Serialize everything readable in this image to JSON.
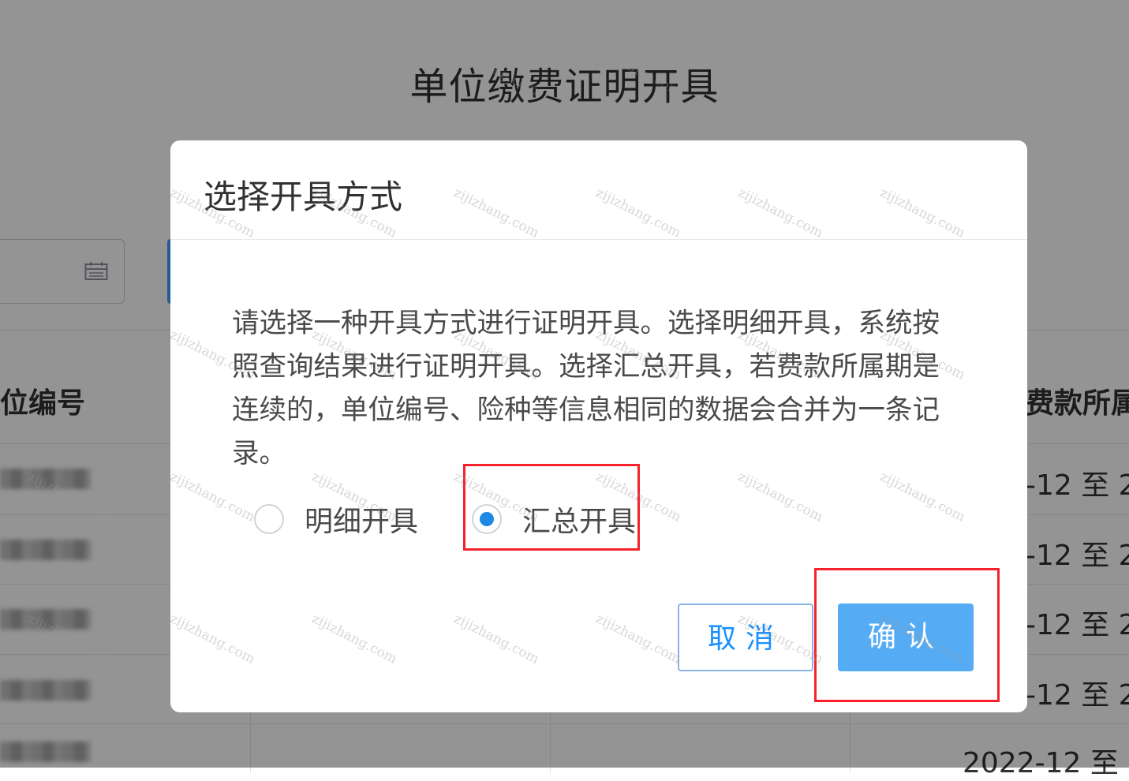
{
  "page": {
    "title": "单位缴费证明开具",
    "table": {
      "col_unit_no": "位编号",
      "col_period": "费款所属",
      "period_rows": [
        "-12 至 2",
        "-12 至 2",
        "-12 至 2",
        "-12 至 2"
      ],
      "period_last": "2022-12 至 2"
    }
  },
  "dialog": {
    "title": "选择开具方式",
    "description": "请选择一种开具方式进行证明开具。选择明细开具，系统按照查询结果进行证明开具。选择汇总开具，若费款所属期是连续的，单位编号、险种等信息相同的数据会合并为一条记录。",
    "options": [
      {
        "label": "明细开具",
        "checked": false
      },
      {
        "label": "汇总开具",
        "checked": true
      }
    ],
    "cancel_label": "取消",
    "confirm_label": "确认"
  },
  "colors": {
    "primary": "#1890ff",
    "confirm_bg": "#55acf5",
    "highlight": "#f5222d"
  },
  "watermark": "zijizhang.com"
}
